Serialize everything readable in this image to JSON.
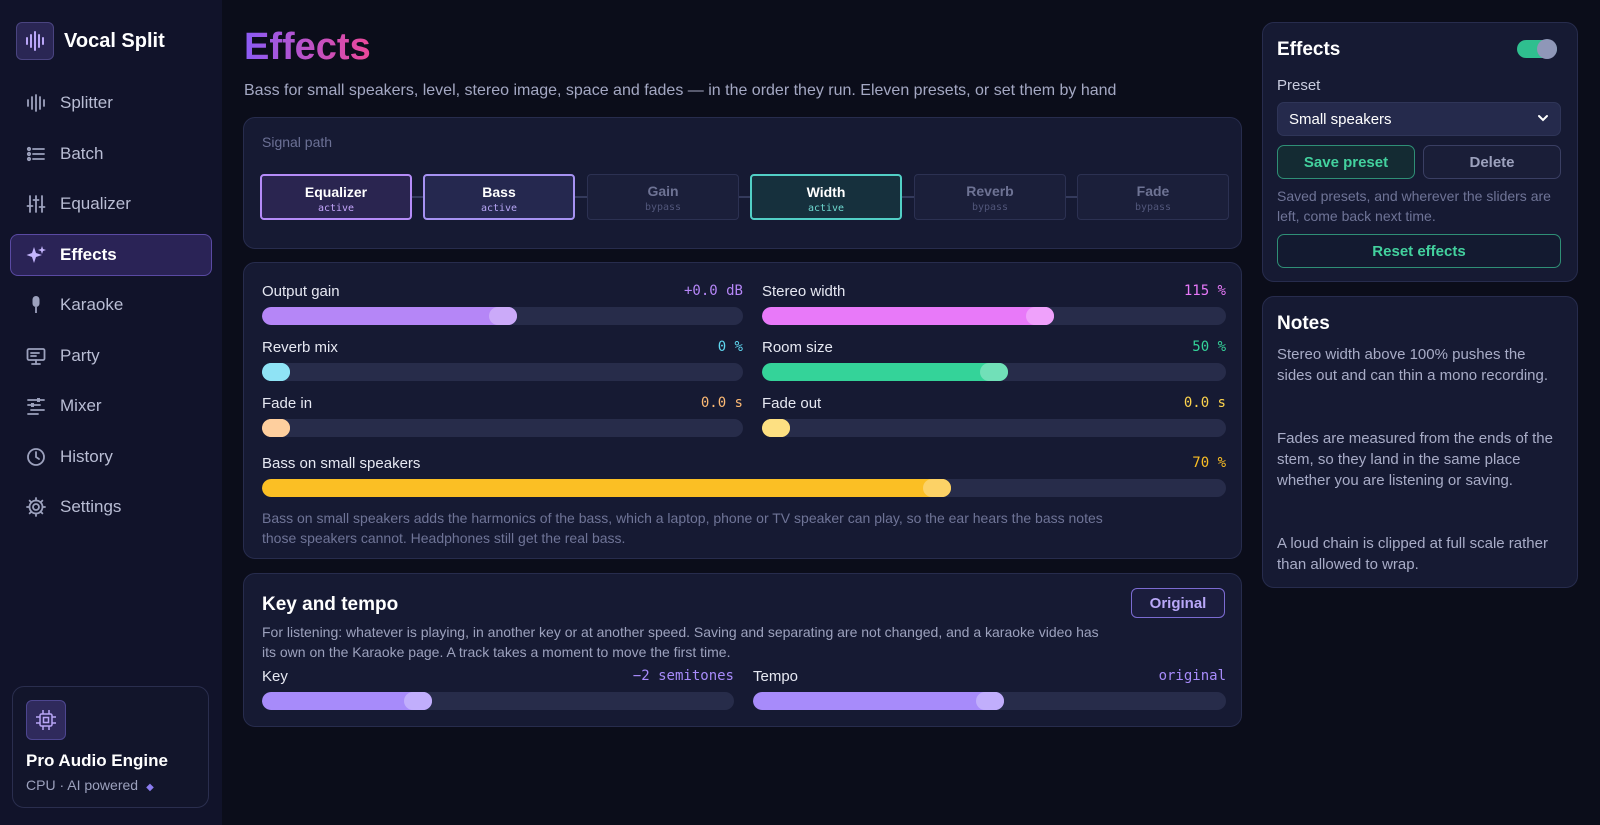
{
  "app": {
    "name": "Vocal Split"
  },
  "sidebar": {
    "items": [
      {
        "label": "Splitter",
        "icon": "waveform-icon"
      },
      {
        "label": "Batch",
        "icon": "list-icon"
      },
      {
        "label": "Equalizer",
        "icon": "sliders-icon"
      },
      {
        "label": "Effects",
        "icon": "sparkle-icon",
        "active": true
      },
      {
        "label": "Karaoke",
        "icon": "microphone-icon"
      },
      {
        "label": "Party",
        "icon": "monitor-icon"
      },
      {
        "label": "Mixer",
        "icon": "mixer-icon"
      },
      {
        "label": "History",
        "icon": "clock-icon"
      },
      {
        "label": "Settings",
        "icon": "gear-icon"
      }
    ],
    "engine": {
      "title": "Pro Audio Engine",
      "subtitle": "CPU · AI powered",
      "dot": "◆",
      "icon": "chip-icon"
    }
  },
  "main": {
    "title": "Effects",
    "subtitle": "Bass for small speakers, level, stereo image, space and fades — in the order they run. Eleven presets, or set them by hand",
    "signal_path": {
      "label": "Signal path",
      "nodes": [
        {
          "name": "Equalizer",
          "state": "active"
        },
        {
          "name": "Bass",
          "state": "active"
        },
        {
          "name": "Gain",
          "state": "bypass"
        },
        {
          "name": "Width",
          "state": "active"
        },
        {
          "name": "Reverb",
          "state": "bypass"
        },
        {
          "name": "Fade",
          "state": "bypass"
        }
      ]
    },
    "sliders": {
      "output_gain": {
        "label": "Output gain",
        "value": "+0.0 dB",
        "level": 0.5,
        "color": "#b586f7"
      },
      "stereo_width": {
        "label": "Stereo width",
        "value": "115 %",
        "level": 0.6,
        "color": "#e879f9"
      },
      "reverb_mix": {
        "label": "Reverb mix",
        "value": "0 %",
        "level": 0.0,
        "color": "#5fd7f0"
      },
      "room_size": {
        "label": "Room size",
        "value": "50 %",
        "level": 0.5,
        "color": "#34d399"
      },
      "fade_in": {
        "label": "Fade in",
        "value": "0.0 s",
        "level": 0.0,
        "color": "#fdba74"
      },
      "fade_out": {
        "label": "Fade out",
        "value": "0.0 s",
        "level": 0.0,
        "color": "#fcd34d"
      },
      "bass_small": {
        "label": "Bass on small speakers",
        "value": "70 %",
        "level": 0.7,
        "color": "#fbbf24"
      }
    },
    "bass_description": "Bass on small speakers adds the harmonics of the bass, which a laptop, phone or TV speaker can play, so the ear hears the bass notes those speakers cannot. Headphones still get the real bass.",
    "key_tempo": {
      "title": "Key and tempo",
      "button": "Original",
      "description": "For listening: whatever is playing, in another key or at another speed. Saving and separating are not changed, and a karaoke video has its own on the Karaoke page. A track takes a moment to move the first time.",
      "key": {
        "label": "Key",
        "value": "−2 semitones",
        "level": 0.33,
        "color": "#a78bfa"
      },
      "tempo": {
        "label": "Tempo",
        "value": "original",
        "level": 0.5,
        "color": "#a78bfa"
      }
    }
  },
  "panel": {
    "title": "Effects",
    "enabled": true,
    "preset_label": "Preset",
    "preset_value": "Small speakers",
    "save_label": "Save preset",
    "delete_label": "Delete",
    "help": "Saved presets, and wherever the sliders are left, come back next time.",
    "reset_label": "Reset effects"
  },
  "notes": {
    "title": "Notes",
    "paragraphs": [
      "Stereo width above 100% pushes the sides out and can thin a mono recording.",
      "Fades are measured from the ends of the stem, so they land in the same place whether you are listening or saving.",
      "A loud chain is clipped at full scale rather than allowed to wrap."
    ]
  },
  "colors": {
    "accent_purple": "#8b5cf6",
    "accent_pink": "#ec4899",
    "accent_green": "#43d19e"
  }
}
